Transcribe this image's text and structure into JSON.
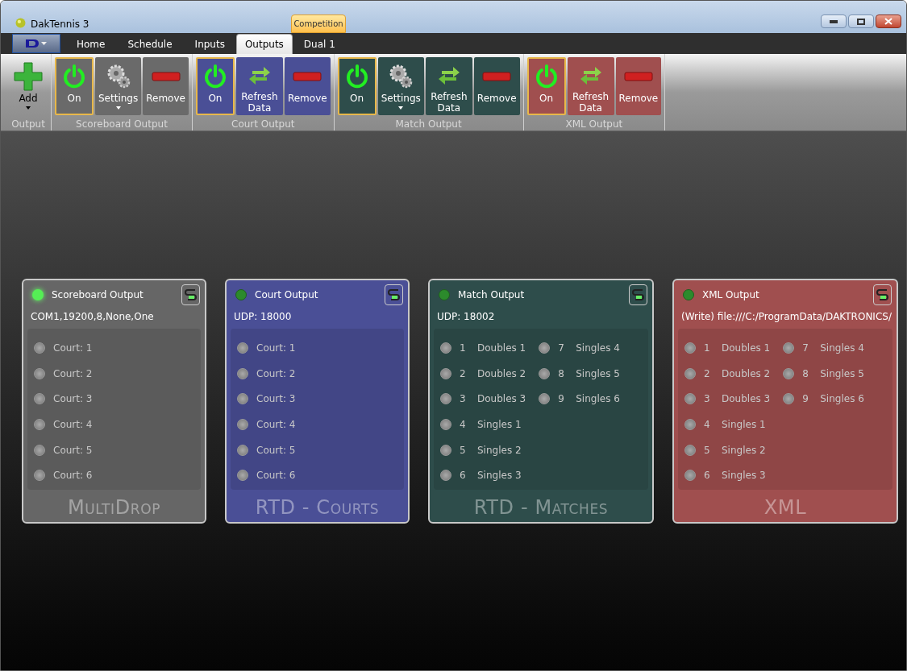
{
  "window": {
    "title": "DakTennis 3",
    "context_tab": "Competition"
  },
  "tabs": [
    {
      "label": "Home",
      "selected": false
    },
    {
      "label": "Schedule",
      "selected": false
    },
    {
      "label": "Inputs",
      "selected": false
    },
    {
      "label": "Outputs",
      "selected": true
    },
    {
      "label": "Dual 1",
      "selected": false
    }
  ],
  "ribbon": [
    {
      "label": "Output",
      "buttons": [
        {
          "kind": "add",
          "label": "Add",
          "checked": false
        }
      ]
    },
    {
      "label": "Scoreboard Output",
      "color": "#6a6a6a",
      "buttons": [
        {
          "kind": "on",
          "label": "On",
          "checked": true
        },
        {
          "kind": "settings",
          "label": "Settings",
          "checked": false
        },
        {
          "kind": "remove",
          "label": "Remove",
          "checked": false
        }
      ]
    },
    {
      "label": "Court Output",
      "color": "#4a4f96",
      "buttons": [
        {
          "kind": "on",
          "label": "On",
          "checked": true
        },
        {
          "kind": "refresh",
          "label": "Refresh Data",
          "checked": false
        },
        {
          "kind": "remove",
          "label": "Remove",
          "checked": false
        }
      ]
    },
    {
      "label": "Match Output",
      "color": "#2e4d4b",
      "buttons": [
        {
          "kind": "on",
          "label": "On",
          "checked": true
        },
        {
          "kind": "settings",
          "label": "Settings",
          "checked": false
        },
        {
          "kind": "refresh",
          "label": "Refresh Data",
          "checked": false
        },
        {
          "kind": "remove",
          "label": "Remove",
          "checked": false
        }
      ]
    },
    {
      "label": "XML Output",
      "color": "#a04f4f",
      "buttons": [
        {
          "kind": "on",
          "label": "On",
          "checked": true
        },
        {
          "kind": "refresh",
          "label": "Refresh Data",
          "checked": false
        },
        {
          "kind": "remove",
          "label": "Remove",
          "checked": false
        }
      ]
    }
  ],
  "cards": [
    {
      "title": "Scoreboard Output",
      "active": true,
      "color": "#666666",
      "connection": "COM1,19200,8,None,One",
      "watermark": "MultiDrop",
      "wide": false,
      "items": [
        {
          "label": "Court: 1"
        },
        {
          "label": "Court: 2"
        },
        {
          "label": "Court: 3"
        },
        {
          "label": "Court: 4"
        },
        {
          "label": "Court: 5"
        },
        {
          "label": "Court: 6"
        }
      ]
    },
    {
      "title": "Court Output",
      "active": false,
      "color": "#4a4f96",
      "connection": "UDP: 18000",
      "watermark": "RTD - Courts",
      "wide": false,
      "items": [
        {
          "label": "Court: 1"
        },
        {
          "label": "Court: 2"
        },
        {
          "label": "Court: 3"
        },
        {
          "label": "Court: 4"
        },
        {
          "label": "Court: 5"
        },
        {
          "label": "Court: 6"
        }
      ]
    },
    {
      "title": "Match Output",
      "active": false,
      "color": "#2e4d4b",
      "connection": "UDP: 18002",
      "watermark": "RTD - Matches",
      "wide": true,
      "items": [
        {
          "number": "1",
          "label": "Doubles 1"
        },
        {
          "number": "2",
          "label": "Doubles 2"
        },
        {
          "number": "3",
          "label": "Doubles 3"
        },
        {
          "number": "4",
          "label": "Singles 1"
        },
        {
          "number": "5",
          "label": "Singles 2"
        },
        {
          "number": "6",
          "label": "Singles 3"
        },
        {
          "number": "7",
          "label": "Singles 4"
        },
        {
          "number": "8",
          "label": "Singles 5"
        },
        {
          "number": "9",
          "label": "Singles 6"
        }
      ]
    },
    {
      "title": "XML Output",
      "active": false,
      "color": "#a04f4f",
      "connection": "(Write) file:///C:/ProgramData/DAKTRONICS/",
      "watermark": "XML",
      "wide": true,
      "items": [
        {
          "number": "1",
          "label": "Doubles 1"
        },
        {
          "number": "2",
          "label": "Doubles 2"
        },
        {
          "number": "3",
          "label": "Doubles 3"
        },
        {
          "number": "4",
          "label": "Singles 1"
        },
        {
          "number": "5",
          "label": "Singles 2"
        },
        {
          "number": "6",
          "label": "Singles 3"
        },
        {
          "number": "7",
          "label": "Singles 4"
        },
        {
          "number": "8",
          "label": "Singles 5"
        },
        {
          "number": "9",
          "label": "Singles 6"
        }
      ]
    }
  ]
}
